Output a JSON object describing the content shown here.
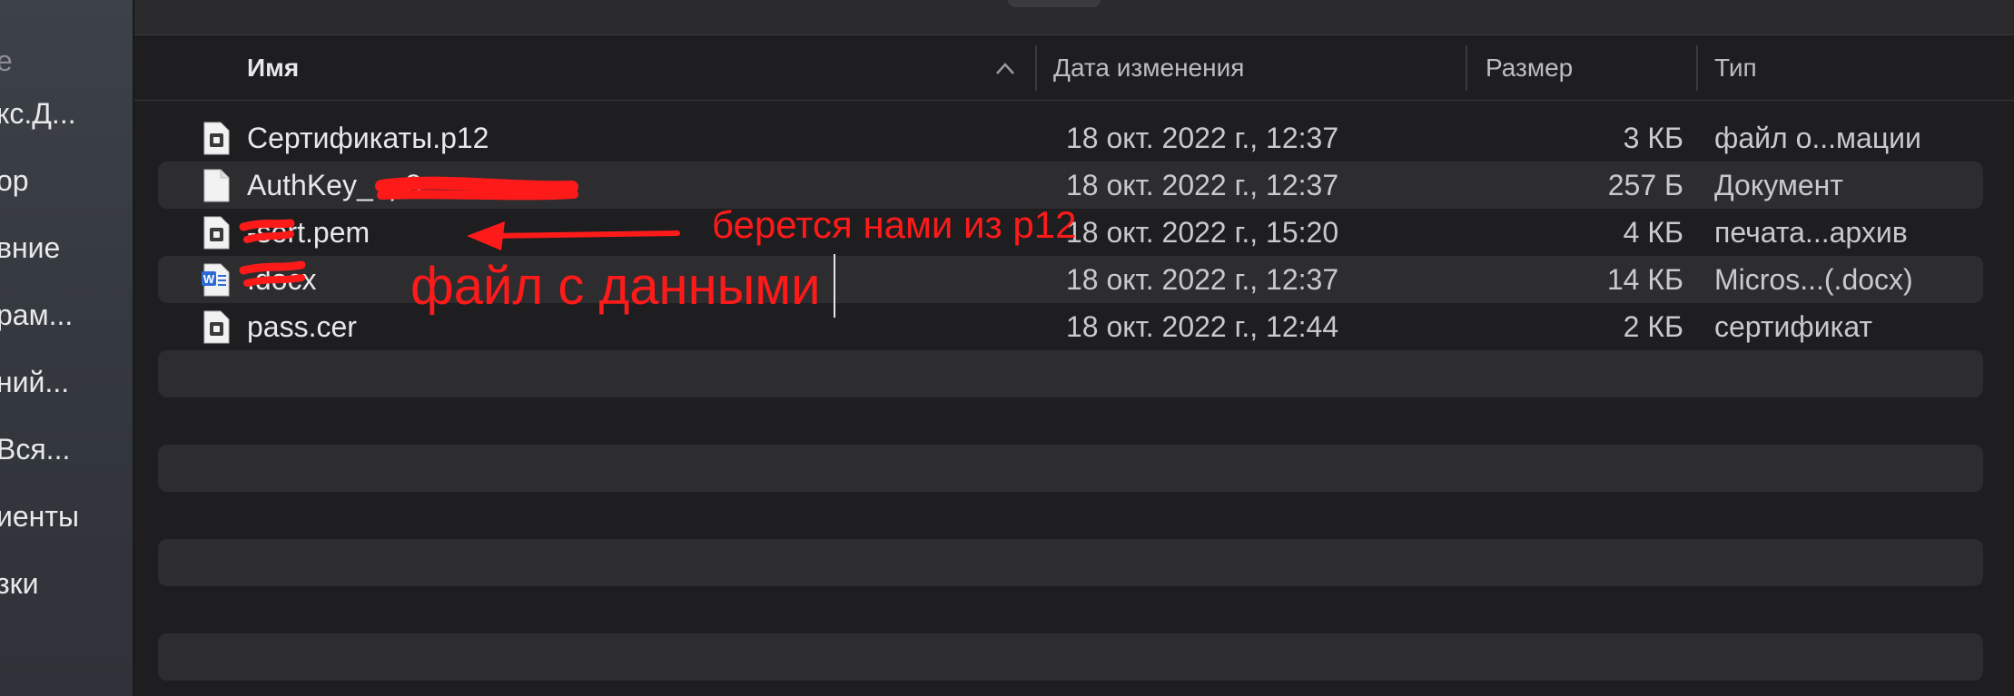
{
  "sidebar": {
    "items": [
      {
        "label": "е",
        "faded": true
      },
      {
        "label": "кс.Д..."
      },
      {
        "label": "ор"
      },
      {
        "label": "вние"
      },
      {
        "label": "рам..."
      },
      {
        "label": "ний..."
      },
      {
        "label": "Вся..."
      },
      {
        "label": "иенты"
      },
      {
        "label": "зки"
      }
    ]
  },
  "columns": {
    "name": "Имя",
    "date": "Дата изменения",
    "size": "Размер",
    "type": "Тип"
  },
  "files": [
    {
      "name": "Сертификаты.p12",
      "date": "18 окт. 2022 г., 12:37",
      "size": "3 КБ",
      "type": "файл о...мации",
      "icon": "document-icon"
    },
    {
      "name": "AuthKey_ .p8",
      "date": "18 окт. 2022 г., 12:37",
      "size": "257 Б",
      "type": "Документ",
      "icon": "blank-document-icon"
    },
    {
      "name": "-sert.pem",
      "date": "18 окт. 2022 г., 15:20",
      "size": "4 КБ",
      "type": "печата...архив",
      "icon": "document-icon"
    },
    {
      "name": ".docx",
      "date": "18 окт. 2022 г., 12:37",
      "size": "14 КБ",
      "type": "Micros...(.docx)",
      "icon": "word-document-icon"
    },
    {
      "name": "pass.cer",
      "date": "18 окт. 2022 г., 12:44",
      "size": "2 КБ",
      "type": "сертификат",
      "icon": "document-icon"
    }
  ],
  "annotations": {
    "pem_note": "берется нами из p12",
    "docx_note": "файл с данными"
  },
  "colors": {
    "annotation": "#ff1a1a",
    "background": "#1e1e20",
    "row_alt": "#2d2d2f"
  }
}
